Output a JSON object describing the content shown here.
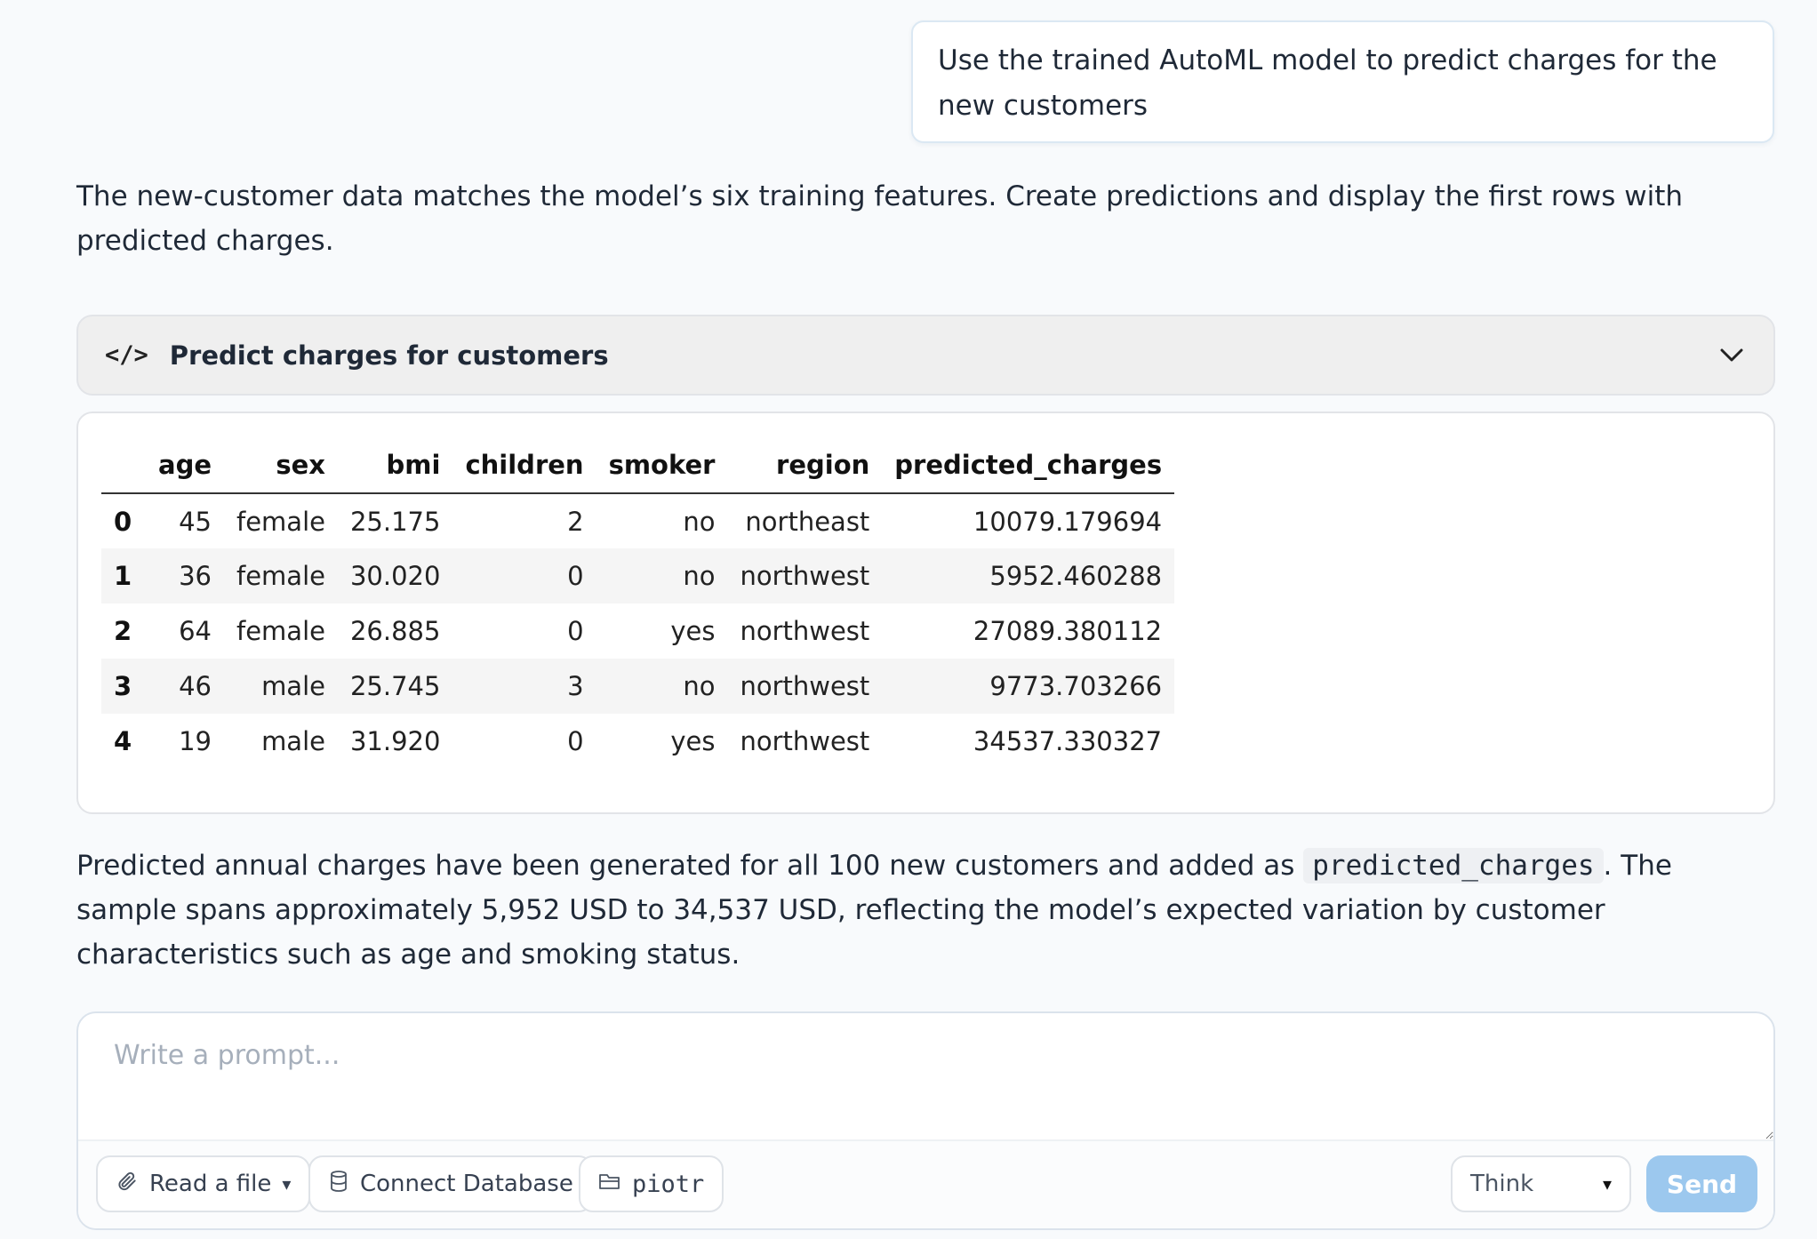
{
  "user_message": {
    "text": "Use the trained AutoML model to predict charges for the new customers"
  },
  "assistant": {
    "intro": "The new-customer data matches the model’s six training features. Create predictions and display the first rows with predicted charges.",
    "code_block": {
      "icon": "code-icon",
      "icon_glyph": "</>",
      "title": "Predict charges for customers"
    },
    "table": {
      "columns": [
        "",
        "age",
        "sex",
        "bmi",
        "children",
        "smoker",
        "region",
        "predicted_charges"
      ],
      "rows": [
        [
          "0",
          "45",
          "female",
          "25.175",
          "2",
          "no",
          "northeast",
          "10079.179694"
        ],
        [
          "1",
          "36",
          "female",
          "30.020",
          "0",
          "no",
          "northwest",
          "5952.460288"
        ],
        [
          "2",
          "64",
          "female",
          "26.885",
          "0",
          "yes",
          "northwest",
          "27089.380112"
        ],
        [
          "3",
          "46",
          "male",
          "25.745",
          "3",
          "no",
          "northwest",
          "9773.703266"
        ],
        [
          "4",
          "19",
          "male",
          "31.920",
          "0",
          "yes",
          "northwest",
          "34537.330327"
        ]
      ]
    },
    "outro_before": "Predicted annual charges have been generated for all 100 new customers and added as ",
    "outro_code": "predicted_charges",
    "outro_after": ". The sample spans approximately 5,952 USD to 34,537 USD, reflecting the model’s expected variation by customer characteristics such as age and smoking status."
  },
  "prompt": {
    "placeholder": "Write a prompt...",
    "read_file_label": "Read a file",
    "read_file_caret": "▾",
    "connect_db_label": "Connect Database",
    "folder_label": "piotr",
    "think_label": "Think",
    "think_caret": "▾",
    "send_label": "Send"
  },
  "colors": {
    "send_button": "#9cc8ee",
    "page_background": "#f8fafc"
  }
}
